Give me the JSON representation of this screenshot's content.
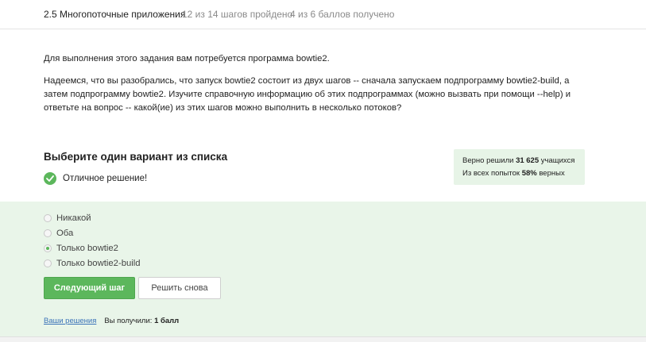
{
  "header": {
    "lesson_title": "2.5 Многопоточные приложения",
    "steps_progress": "12 из 14 шагов пройдено",
    "score_progress": "4 из 6 баллов  получено"
  },
  "task": {
    "paragraph1": "Для выполнения этого задания вам потребуется программа bowtie2.",
    "paragraph2": "Надеемся, что вы разобрались, что запуск bowtie2 состоит из двух шагов -- сначала запускаем подпрограмму bowtie2-build, а затем подпрограмму bowtie2. Изучите справочную информацию об этих подпрограммах (можно вызвать при помощи --help) и ответьте на вопрос -- какой(ие) из этих шагов можно выполнить в несколько потоков?"
  },
  "quiz": {
    "title": "Выберите один вариант из списка",
    "feedback": "Отличное решение!",
    "options": [
      {
        "label": "Никакой",
        "selected": false
      },
      {
        "label": "Оба",
        "selected": false
      },
      {
        "label": "Только bowtie2",
        "selected": true
      },
      {
        "label": "Только bowtie2-build",
        "selected": false
      }
    ],
    "next_button": "Следующий шаг",
    "retry_button": "Решить снова",
    "solutions_link": "Ваши решения",
    "received_prefix": "Вы получили:",
    "received_value": "1 балл"
  },
  "stats": {
    "solved_prefix": "Верно решили",
    "solved_count": "31 625",
    "solved_suffix": "учащихся",
    "attempts_prefix": "Из всех попыток",
    "attempts_percent": "58%",
    "attempts_suffix": "верных"
  },
  "colors": {
    "accent_green": "#5cb75c",
    "answer_bg": "#e9f5e9",
    "stats_bg": "#e7f4e7",
    "link": "#3a72b8"
  },
  "icons": {
    "feedback_icon": "check-circle-icon"
  }
}
